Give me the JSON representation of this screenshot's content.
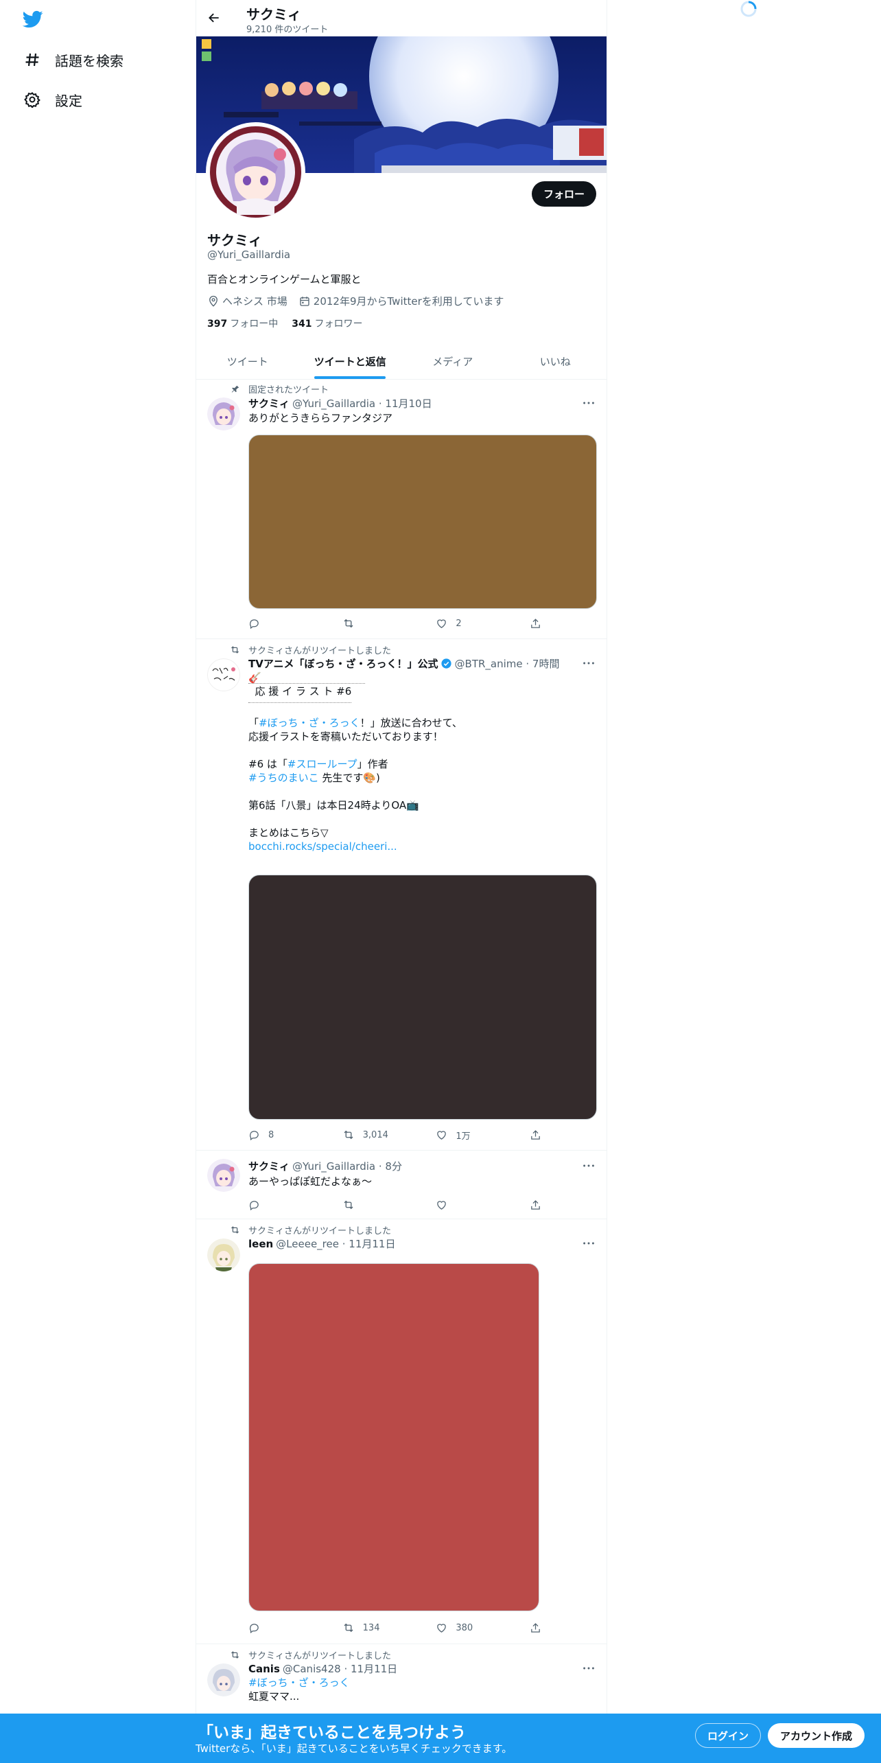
{
  "colors": {
    "accent": "#1d9bf0",
    "text": "#0f1419",
    "secondary": "#536471",
    "divider": "#eff3f4"
  },
  "sidebar": {
    "logo": "twitter-bird-icon",
    "items": [
      {
        "label": "話題を検索",
        "icon": "hashtag-icon"
      },
      {
        "label": "設定",
        "icon": "gear-icon"
      }
    ]
  },
  "header": {
    "title": "サクミィ",
    "tweet_count": "9,210 件のツイート"
  },
  "profile": {
    "name": "サクミィ",
    "handle": "@Yuri_Gaillardia",
    "bio": "百合とオンラインゲームと軍服と",
    "location": "ヘネシス 市場",
    "joined": "2012年9月からTwitterを利用しています",
    "following_count": "397",
    "following_label": "フォロー中",
    "followers_count": "341",
    "followers_label": "フォロワー",
    "follow_button": "フォロー"
  },
  "tabs": [
    {
      "label": "ツイート",
      "active": false
    },
    {
      "label": "ツイートと返信",
      "active": true
    },
    {
      "label": "メディア",
      "active": false
    },
    {
      "label": "いいね",
      "active": false
    }
  ],
  "tweets": [
    {
      "context": "固定されたツイート",
      "name": "サクミィ",
      "meta": "@Yuri_Gaillardia · 11月10日",
      "text": "ありがとうきららファンタジア",
      "media_color": "#8b6636",
      "replies": "",
      "retweets": "",
      "likes": "2"
    },
    {
      "context": "サクミィさんがリツイートしました",
      "name": "TVアニメ「ぼっち・ざ・ろっく！」公式",
      "meta": "@BTR_anime · 7時間",
      "lines": {
        "l1": "🎸",
        "l2": "  応 援 イ ラ ス ト #6",
        "l3a": "「",
        "l3_tag": "#ぼっち・ざ・ろっく",
        "l3b": "！」放送に合わせて、",
        "l4": "応援イラストを寄稿いただいております！",
        "l5a": "#6 は「",
        "l5_tag": "#スローループ",
        "l5b": "」作者",
        "l6_tag": "#うちのまいこ",
        "l6b": " 先生です🎨)",
        "l7": "第6話「八景」は本日24時よりOA📺",
        "l8": "まとめはこちら▽",
        "l9_link": "bocchi.rocks/special/cheeri..."
      },
      "media_color": "#342b2c",
      "replies": "8",
      "retweets": "3,014",
      "likes": "1万"
    },
    {
      "context": "",
      "name": "サクミィ",
      "meta": "@Yuri_Gaillardia · 8分",
      "text": "あーやっぱぽ虹だよなぁ〜",
      "replies": "",
      "retweets": "",
      "likes": ""
    },
    {
      "context": "サクミィさんがリツイートしました",
      "name": "leen",
      "meta": "@Leeee_ree · 11月11日",
      "media_color": "#b94a48",
      "replies": "",
      "retweets": "134",
      "likes": "380"
    },
    {
      "context": "サクミィさんがリツイートしました",
      "name": "Canis",
      "meta": "@Canis428 · 11月11日",
      "hashtag": "#ぼっち・ざ・ろっく",
      "text": "虹夏ママ..."
    }
  ],
  "bottom_bar": {
    "title": "「いま」起きていることを見つけよう",
    "subtitle": "Twitterなら、「いま」起きていることをいち早くチェックできます。",
    "login": "ログイン",
    "signup": "アカウント作成"
  }
}
